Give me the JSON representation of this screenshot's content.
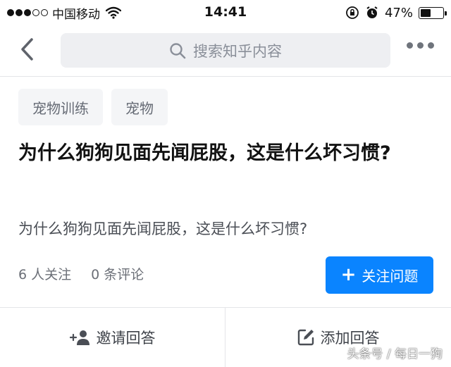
{
  "status_bar": {
    "carrier": "中国移动",
    "time": "14:41",
    "battery_percent_text": "47%",
    "battery_level": 0.47,
    "signal_bars_filled": 3,
    "signal_bars_total": 5
  },
  "nav": {
    "back_icon": "chevron-left-icon",
    "search_icon": "search-icon",
    "search_placeholder": "搜索知乎内容",
    "more_icon": "more-horizontal-icon"
  },
  "tags": [
    "宠物训练",
    "宠物"
  ],
  "question": {
    "title": "为什么狗狗见面先闻屁股，这是什么坏习惯?",
    "detail": "为什么狗狗见面先闻屁股，这是什么坏习惯?"
  },
  "meta": {
    "followers": "6 人关注",
    "comments": "0 条评论"
  },
  "follow_button": {
    "icon": "+",
    "label": "关注问题",
    "color": "#0a84ff"
  },
  "actions": {
    "invite": {
      "icon": "add-user-icon",
      "label": "邀请回答"
    },
    "answer": {
      "icon": "edit-icon",
      "label": "添加回答"
    }
  },
  "watermark": "头条号 / 每日一狗"
}
